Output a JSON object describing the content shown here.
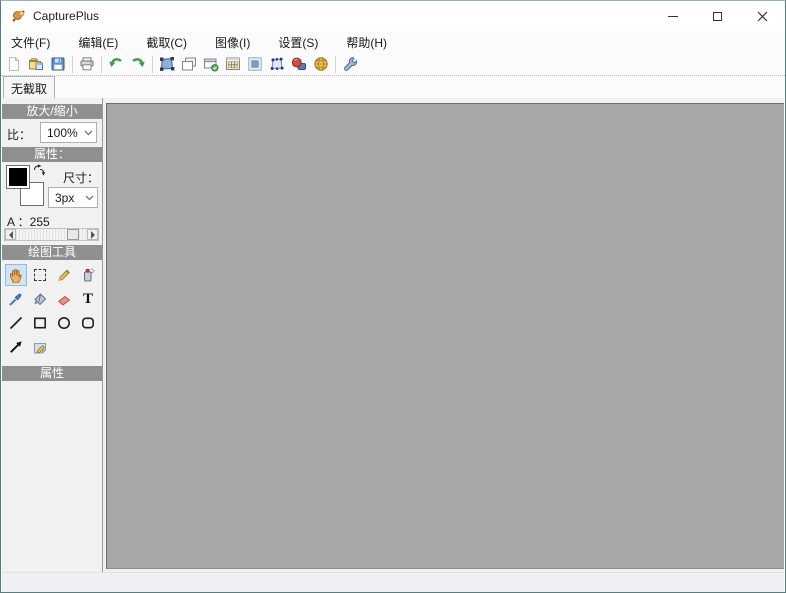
{
  "window": {
    "title": "CapturePlus"
  },
  "menu": {
    "items": [
      "文件(F)",
      "编辑(E)",
      "截取(C)",
      "图像(I)",
      "设置(S)",
      "帮助(H)"
    ]
  },
  "toolbar": {
    "buttons": [
      "new-file",
      "open-file",
      "save",
      "print",
      "undo",
      "redo",
      "capture-region",
      "capture-window",
      "capture-active-window",
      "capture-control",
      "capture-fullscreen",
      "capture-polygon",
      "capture-objects",
      "capture-web",
      "settings"
    ]
  },
  "tabs": {
    "active": "无截取"
  },
  "sidebar": {
    "zoom": {
      "header": "放大/缩小",
      "ratio_label": "比：",
      "value": "100%"
    },
    "properties": {
      "header": "属性：",
      "size_label": "尺寸：",
      "size_value": "3px",
      "alpha_label": "A ：255"
    },
    "tools": {
      "header": "绘图工具",
      "items": [
        "hand",
        "select",
        "pen",
        "spray",
        "eyedropper",
        "fill",
        "eraser",
        "text",
        "line",
        "rectangle",
        "ellipse",
        "rounded-rectangle",
        "arrow",
        "note"
      ],
      "selected": "hand",
      "text_glyph": "T"
    },
    "bottom": {
      "header": "属性"
    }
  },
  "statusbar": {
    "text": ""
  },
  "colors": {
    "canvas": "#a8a8a8",
    "section_header": "#8f8f8f",
    "selected_tool_bg": "#cfe4f7",
    "selected_tool_border": "#90bce4",
    "window_border": "#4e8184",
    "foreground_color": "#000000",
    "background_color": "#ffffff"
  }
}
